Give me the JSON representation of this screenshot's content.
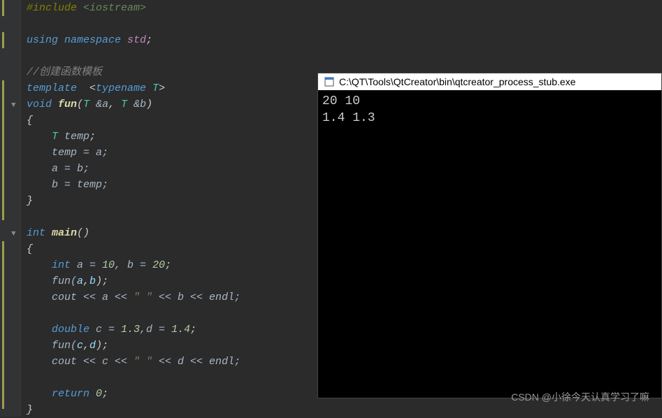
{
  "code": {
    "line1_directive": "#include",
    "line1_header": " <iostream>",
    "line3_using": "using",
    "line3_namespace": " namespace",
    "line3_std": " std",
    "line3_semi": ";",
    "line5_comment": "//创建函数模板",
    "line6_template": "template",
    "line6_angle_open": "  <",
    "line6_typename": "typename",
    "line6_T": " T",
    "line6_angle_close": ">",
    "line7_void": "void",
    "line7_fun": " fun",
    "line7_paren_open": "(",
    "line7_T1": "T ",
    "line7_amp_a": "&a",
    "line7_comma": ", ",
    "line7_T2": "T ",
    "line7_amp_b": "&b",
    "line7_paren_close": ")",
    "line8_brace": "{",
    "line9_T": "    T ",
    "line9_temp": "temp",
    "line9_semi": ";",
    "line10": "    temp = a;",
    "line11": "    a = b;",
    "line12": "    b = temp;",
    "line13_brace": "}",
    "line15_int": "int",
    "line15_main": " main",
    "line15_parens": "()",
    "line16_brace": "{",
    "line17_int": "    int",
    "line17_a": " a = ",
    "line17_10": "10",
    "line17_comma": ", b = ",
    "line17_20": "20",
    "line17_semi": ";",
    "line18_fun": "    fun(",
    "line18_a": "a",
    "line18_comma": ",",
    "line18_b": "b",
    "line18_close": ");",
    "line19_cout": "    cout << a << ",
    "line19_str": "\" \"",
    "line19_rest": " << b << endl;",
    "line21_double": "    double",
    "line21_c": " c = ",
    "line21_13": "1.3",
    "line21_comma": ",d = ",
    "line21_14": "1.4",
    "line21_semi": ";",
    "line22_fun": "    fun(",
    "line22_c": "c",
    "line22_comma": ",",
    "line22_d": "d",
    "line22_close": ");",
    "line23_cout": "    cout << c << ",
    "line23_str": "\" \"",
    "line23_rest": " << d << endl;",
    "line25_return": "    return",
    "line25_0": " 0",
    "line25_semi": ";",
    "line26_brace": "}"
  },
  "console": {
    "title": "C:\\QT\\Tools\\QtCreator\\bin\\qtcreator_process_stub.exe",
    "line1": "20 10",
    "line2": "1.4 1.3"
  },
  "watermark": "CSDN @小徐今天认真学习了嘛"
}
